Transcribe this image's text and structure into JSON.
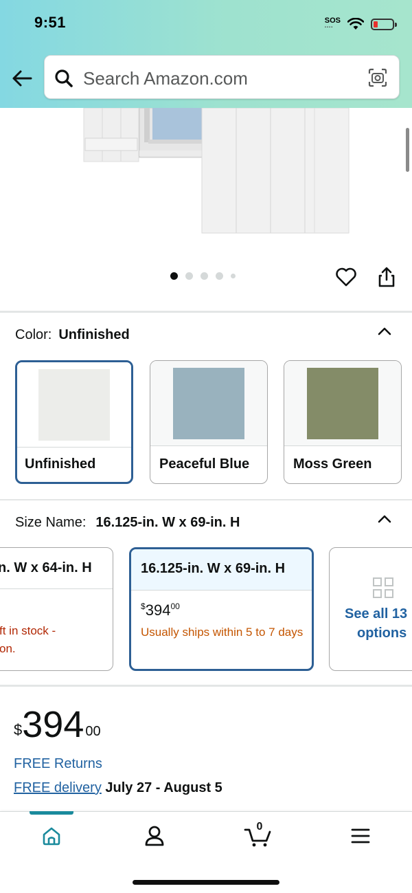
{
  "status_bar": {
    "time": "9:51",
    "sos": "SOS"
  },
  "search": {
    "placeholder": "Search Amazon.com"
  },
  "gallery": {
    "image_count": 5,
    "active_index": 0
  },
  "color": {
    "label": "Color:",
    "selected_value": "Unfinished",
    "options": [
      {
        "name": "Unfinished",
        "color": "#ecedea",
        "selected": true
      },
      {
        "name": "Peaceful Blue",
        "color": "#99b2be",
        "selected": false
      },
      {
        "name": "Moss Green",
        "color": "#848c68",
        "selected": false
      }
    ]
  },
  "size": {
    "label": "Size Name:",
    "selected_value": "16.125-in. W x 69-in. H",
    "options": [
      {
        "name": "n. W x 64-in. H",
        "stock": "ft in stock -",
        "stock_line2": "on."
      },
      {
        "name": "16.125-in. W x 69-in. H",
        "price_symbol": "$",
        "price_whole": "394",
        "price_cents": "00",
        "shipping": "Usually ships within 5 to 7 days",
        "selected": true
      }
    ],
    "see_all": {
      "line1": "See all 13",
      "line2": "options"
    }
  },
  "price": {
    "symbol": "$",
    "whole": "394",
    "cents": "00"
  },
  "free_returns": "FREE Returns",
  "delivery": {
    "link": "FREE delivery",
    "dates": "July 27 - August 5"
  },
  "bottom_nav": {
    "cart_count": "0",
    "active": "home"
  },
  "colors": {
    "accent_teal": "#1a8a9c",
    "link_blue": "#2162a1",
    "selected_border": "#2d5f94",
    "ship_orange": "#c45500"
  }
}
